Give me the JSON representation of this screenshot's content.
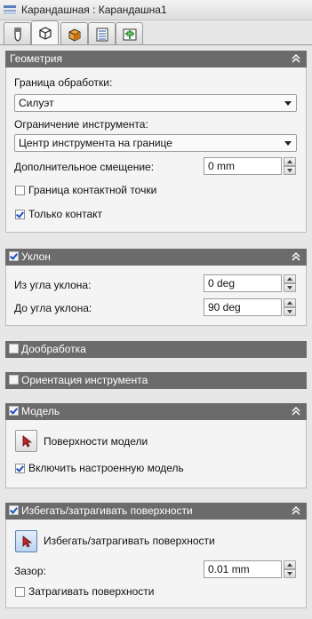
{
  "window": {
    "title": "Карандашная : Карандашна1"
  },
  "tabs": [
    {
      "icon": "tool-icon"
    },
    {
      "icon": "cube-outline-icon"
    },
    {
      "icon": "orange-cube-icon"
    },
    {
      "icon": "list-page-icon"
    },
    {
      "icon": "green-tree-icon"
    }
  ],
  "geometry": {
    "title": "Геометрия",
    "machining_boundary_label": "Граница обработки:",
    "machining_boundary_value": "Силуэт",
    "tool_containment_label": "Ограничение инструмента:",
    "tool_containment_value": "Центр инструмента на границе",
    "offset_label": "Дополнительное смещение:",
    "offset_value": "0 mm",
    "contact_point_label": "Граница контактной точки",
    "contact_point_checked": false,
    "contact_only_label": "Только контакт",
    "contact_only_checked": true
  },
  "slope": {
    "title": "Уклон",
    "enabled": true,
    "from_label": "Из угла уклона:",
    "from_value": "0 deg",
    "to_label": "До угла уклона:",
    "to_value": "90 deg"
  },
  "rest": {
    "title": "Дообработка",
    "enabled": false
  },
  "tool_orientation": {
    "title": "Ориентация инструмента",
    "enabled": false
  },
  "model": {
    "title": "Модель",
    "enabled": true,
    "surfaces_label": "Поверхности модели",
    "stock_label": "Включить настроенную модель",
    "stock_checked": true
  },
  "avoid": {
    "title": "Избегать/затрагивать поверхности",
    "enabled": true,
    "surfaces_label": "Избегать/затрагивать поверхности",
    "clearance_label": "Зазор:",
    "clearance_value": "0.01 mm",
    "touch_label": "Затрагивать поверхности",
    "touch_checked": false
  },
  "colors": {
    "section_header": "#6b6b6b",
    "check_mark": "#1d4fc4",
    "accent": "#5a7fb5"
  }
}
